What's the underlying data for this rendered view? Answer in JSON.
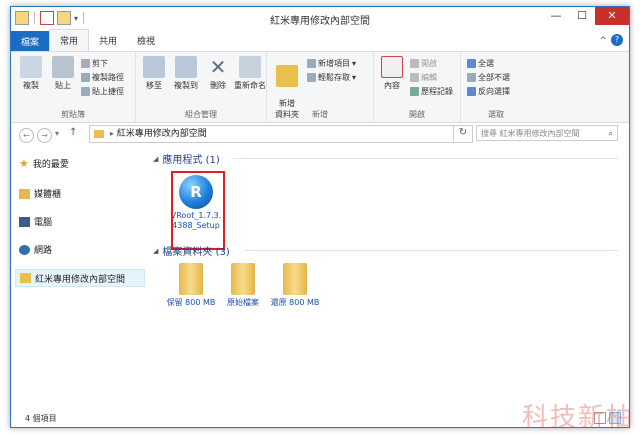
{
  "window": {
    "title": "紅米專用修改內部空間",
    "min": "—",
    "max": "☐",
    "close": "✕"
  },
  "tabs": [
    {
      "label": "檔案"
    },
    {
      "label": "常用"
    },
    {
      "label": "共用"
    },
    {
      "label": "檢視"
    }
  ],
  "ribbon": {
    "clipboard": {
      "copy": "複製",
      "paste": "貼上",
      "cut": "剪下",
      "copy_path": "複製路徑",
      "paste_shortcut": "貼上捷徑",
      "label": "剪貼簿"
    },
    "organize": {
      "move_to": "移至",
      "copy_to": "複製到",
      "delete": "刪除",
      "rename": "重新命名",
      "label": "組合管理"
    },
    "new": {
      "new_folder": "新增\n資料夾",
      "new_item": "新增項目",
      "easy_access": "輕鬆存取",
      "label": "新增"
    },
    "open": {
      "properties": "內容",
      "open": "開啟",
      "edit": "編輯",
      "history": "歷程記錄",
      "label": "開啟"
    },
    "select": {
      "select_all": "全選",
      "select_none": "全部不選",
      "invert": "反向選擇",
      "label": "選取"
    }
  },
  "address": {
    "path": "紅米專用修改內部空間",
    "search_placeholder": "搜尋 紅米專用修改內部空間"
  },
  "sidebar": {
    "items": [
      {
        "label": "我的最愛",
        "icon": "star-icon"
      },
      {
        "label": "媒體櫃",
        "icon": "library-icon"
      },
      {
        "label": "電腦",
        "icon": "computer-icon"
      },
      {
        "label": "網路",
        "icon": "network-icon"
      },
      {
        "label": "紅米專用修改內部空間",
        "icon": "folder-icon"
      }
    ]
  },
  "groups": {
    "apps": {
      "title": "應用程式 (1)"
    },
    "folders": {
      "title": "檔案資料夾 (3)"
    }
  },
  "files": {
    "app": {
      "name": "VRoot_1.7.3.4388_Setup",
      "icon_glyph": "R"
    },
    "folders": [
      {
        "name": "保留 800 MB"
      },
      {
        "name": "原始檔案"
      },
      {
        "name": "還原 800 MB"
      }
    ]
  },
  "status": {
    "count": "4 個項目"
  },
  "watermark": "科技新柚",
  "colors": {
    "accent": "#1a6cc4",
    "selection_outline": "#e0201f",
    "folder": "#e9c04b"
  }
}
